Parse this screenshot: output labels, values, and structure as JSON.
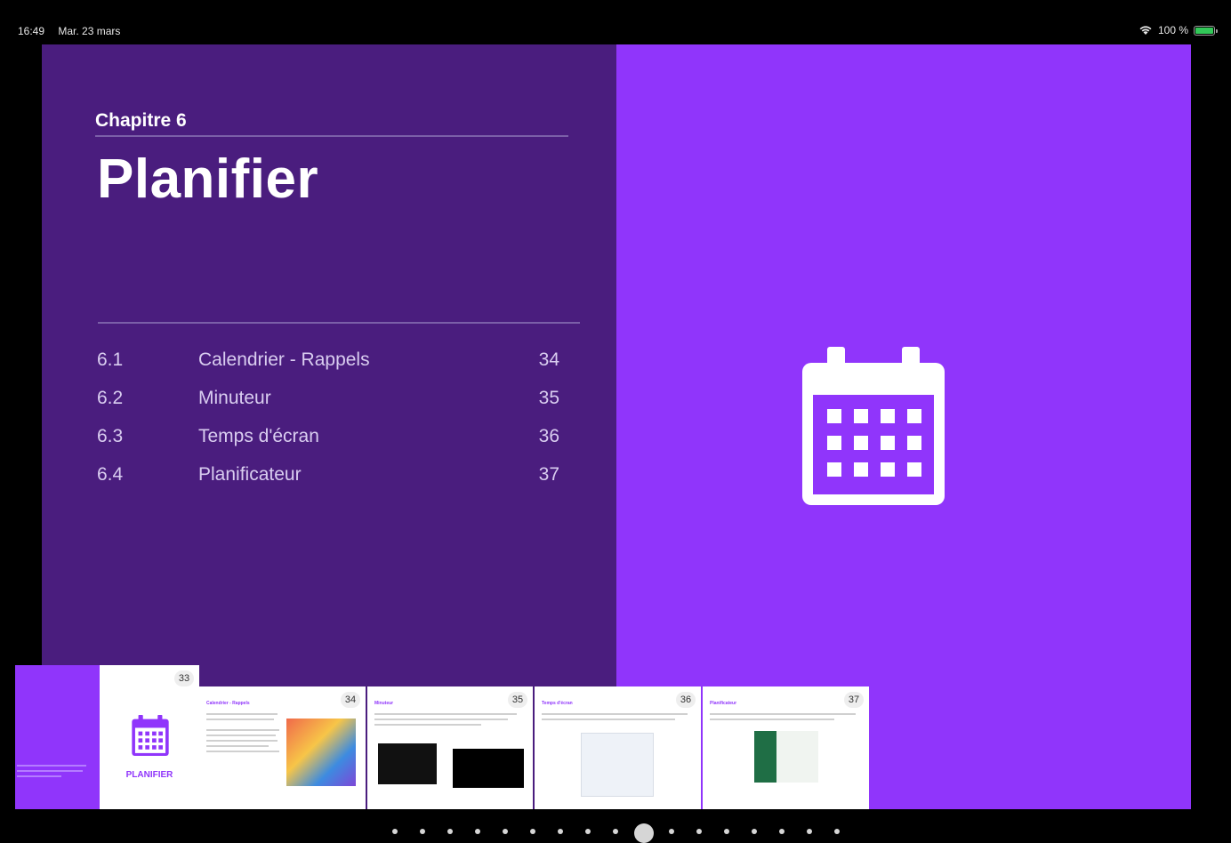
{
  "status_bar": {
    "time": "16:49",
    "date": "Mar. 23 mars",
    "battery_text": "100 %",
    "icons": [
      "wifi-icon",
      "battery-icon"
    ],
    "battery_color": "#32c758"
  },
  "chapter": {
    "label": "Chapitre 6",
    "title": "Planifier",
    "icon": "calendar-icon"
  },
  "toc": [
    {
      "num": "6.1",
      "title": "Calendrier - Rappels",
      "page": "34"
    },
    {
      "num": "6.2",
      "title": "Minuteur",
      "page": "35"
    },
    {
      "num": "6.3",
      "title": "Temps d'écran",
      "page": "36"
    },
    {
      "num": "6.4",
      "title": "Planificateur",
      "page": "37"
    }
  ],
  "thumbnails": [
    {
      "page": "33",
      "label": "PLANIFIER"
    },
    {
      "page": "34",
      "heading": "Calendrier - Rappels"
    },
    {
      "page": "35",
      "heading": "Minuteur"
    },
    {
      "page": "36",
      "heading": "Temps d'écran"
    },
    {
      "page": "37",
      "heading": "Planificateur"
    }
  ],
  "colors": {
    "left_page": "#4a1d7e",
    "right_page": "#9035fb",
    "accent": "#9035fb"
  }
}
